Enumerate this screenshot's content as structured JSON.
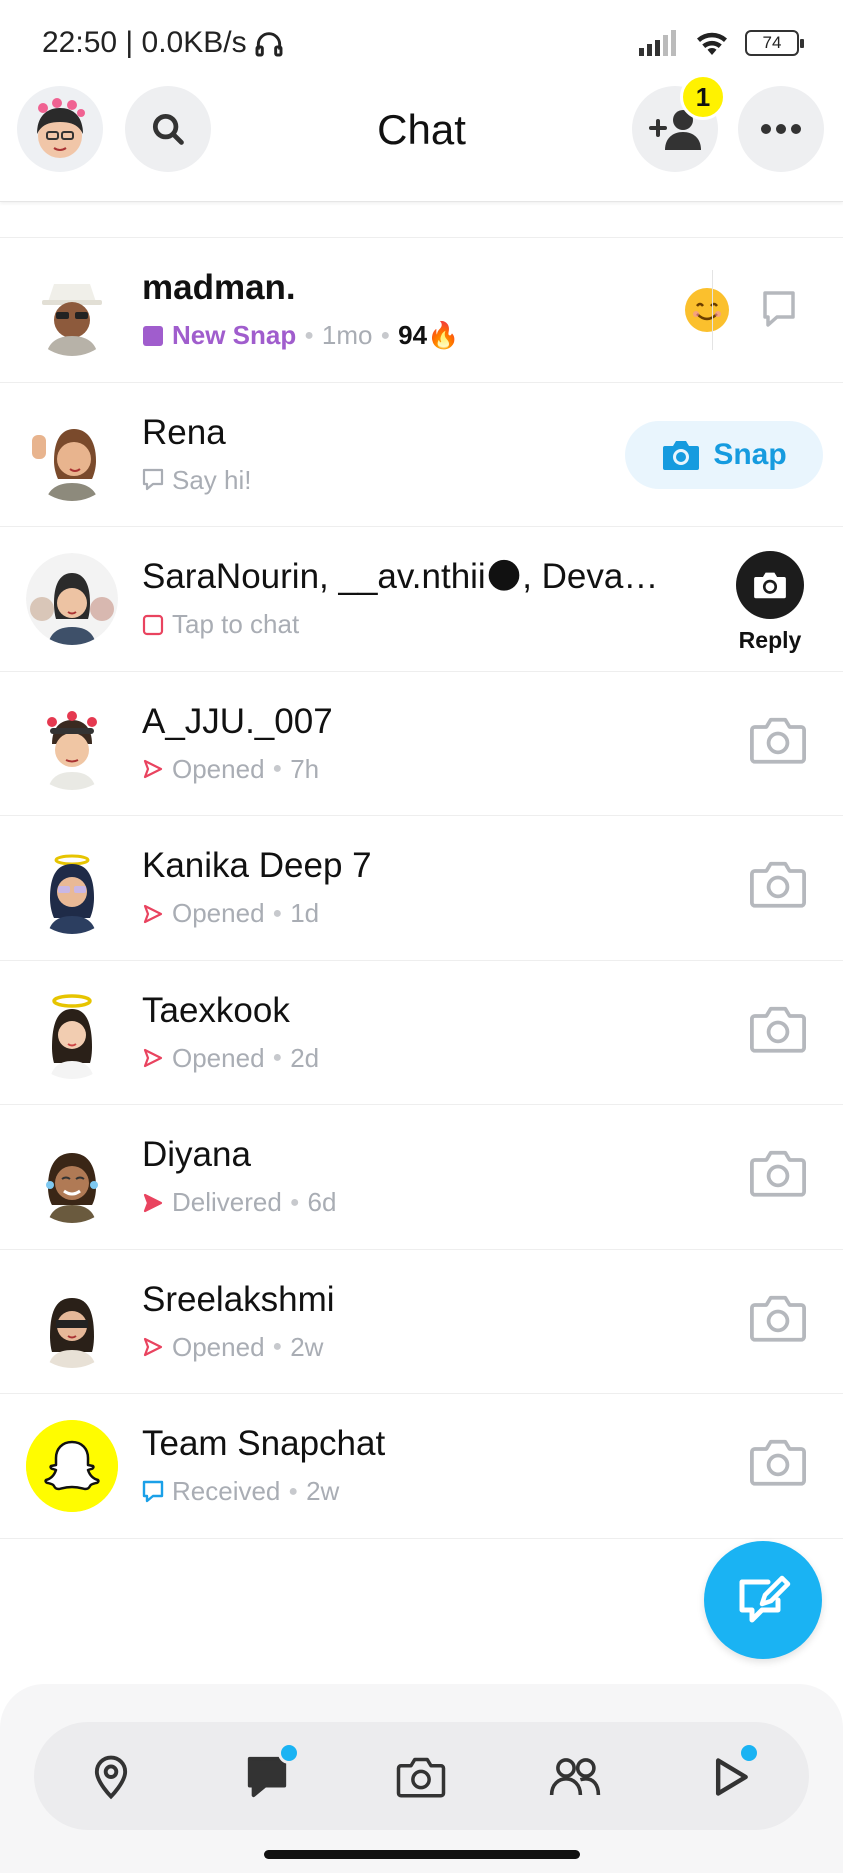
{
  "status_bar": {
    "time_speed": "22:50 | 0.0KB/s",
    "battery": "74"
  },
  "header": {
    "title": "Chat",
    "friend_request_count": "1"
  },
  "chats": [
    {
      "name": "madman.",
      "status": "New Snap",
      "time": "1mo",
      "streak": "94🔥",
      "status_color": "#a05dcd"
    },
    {
      "name": "Rena",
      "status": "Say hi!",
      "action_label": "Snap"
    },
    {
      "name": "SaraNourin, __av.nthii🌑, Deva…",
      "status": "Tap to chat",
      "action_label": "Reply"
    },
    {
      "name": "A_JJU._007",
      "status": "Opened",
      "time": "7h"
    },
    {
      "name": "Kanika Deep 7",
      "status": "Opened",
      "time": "1d"
    },
    {
      "name": "Taexkook",
      "status": "Opened",
      "time": "2d"
    },
    {
      "name": "Diyana",
      "status": "Delivered",
      "time": "6d"
    },
    {
      "name": "Sreelakshmi",
      "status": "Opened",
      "time": "2w"
    },
    {
      "name": "Team Snapchat",
      "status": "Received",
      "time": "2w"
    }
  ],
  "colors": {
    "accent_blue": "#1ab3f3",
    "snap_red": "#e9435f",
    "new_snap_purple": "#a05dcd",
    "received_blue": "#1aa0e8",
    "badge_yellow": "#fff200"
  },
  "nav": {
    "items": [
      "map-pin-icon",
      "chat-icon",
      "camera-icon",
      "friends-icon",
      "play-icon"
    ]
  }
}
